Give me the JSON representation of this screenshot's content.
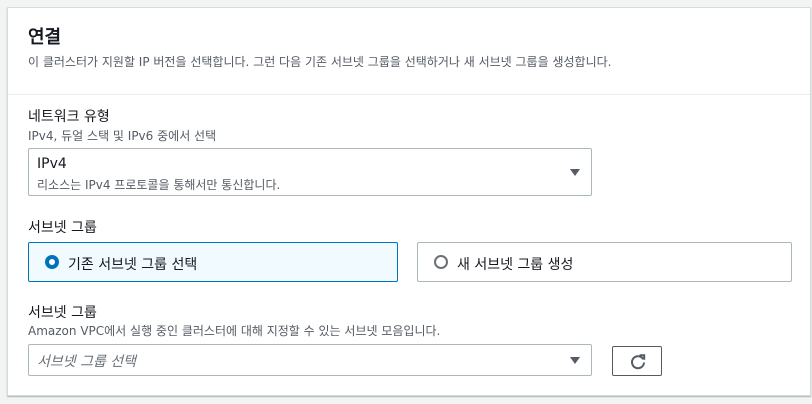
{
  "section": {
    "title": "연결",
    "description": "이 클러스터가 지원할 IP 버전을 선택합니다. 그런 다음 기존 서브넷 그룹을 선택하거나 새 서브넷 그룹을 생성합니다."
  },
  "network_type": {
    "label": "네트워크 유형",
    "help": "IPv4, 듀얼 스택 및 IPv6 중에서 선택",
    "selected_value": "IPv4",
    "selected_description": "리소스는 IPv4 프로토콜을 통해서만 통신합니다."
  },
  "subnet_group_choice": {
    "label": "서브넷 그룹",
    "options": [
      {
        "label": "기존 서브넷 그룹 선택",
        "selected": true
      },
      {
        "label": "새 서브넷 그룹 생성",
        "selected": false
      }
    ]
  },
  "subnet_group_select": {
    "label": "서브넷 그룹",
    "help": "Amazon VPC에서 실행 중인 클러스터에 대해 지정할 수 있는 서브넷 모음입니다.",
    "placeholder": "서브넷 그룹 선택"
  },
  "icons": {
    "dropdown": "caret-down-icon",
    "refresh": "refresh-icon"
  },
  "colors": {
    "accent": "#0073bb",
    "selected_tile_bg": "#f1faff",
    "text": "#16191f",
    "secondary_text": "#545b64"
  }
}
